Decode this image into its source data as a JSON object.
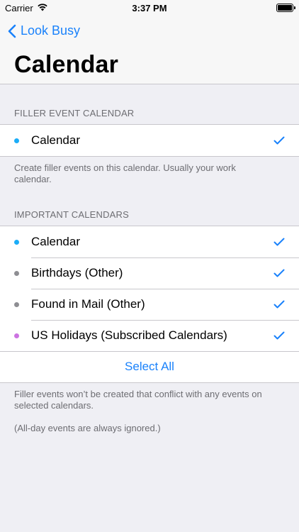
{
  "status_bar": {
    "carrier": "Carrier",
    "time": "3:37 PM"
  },
  "nav": {
    "back_label": "Look Busy",
    "title": "Calendar"
  },
  "filler_section": {
    "header": "FILLER EVENT CALENDAR",
    "rows": [
      {
        "label": "Calendar",
        "color": "#1badf8",
        "checked": true
      }
    ],
    "footer": "Create filler events on this calendar. Usually your work calendar."
  },
  "important_section": {
    "header": "IMPORTANT CALENDARS",
    "rows": [
      {
        "label": "Calendar",
        "color": "#1badf8",
        "checked": true
      },
      {
        "label": "Birthdays (Other)",
        "color": "#8e8e93",
        "checked": true
      },
      {
        "label": "Found in Mail (Other)",
        "color": "#8e8e93",
        "checked": true
      },
      {
        "label": "US Holidays (Subscribed Calendars)",
        "color": "#cc73e1",
        "checked": true
      }
    ],
    "select_all_label": "Select All",
    "footer_lines": [
      "Filler events won’t be created that conflict with any events on selected calendars.",
      "(All-day events are always ignored.)"
    ]
  },
  "colors": {
    "accent": "#1a82fb",
    "background": "#efeff4"
  }
}
